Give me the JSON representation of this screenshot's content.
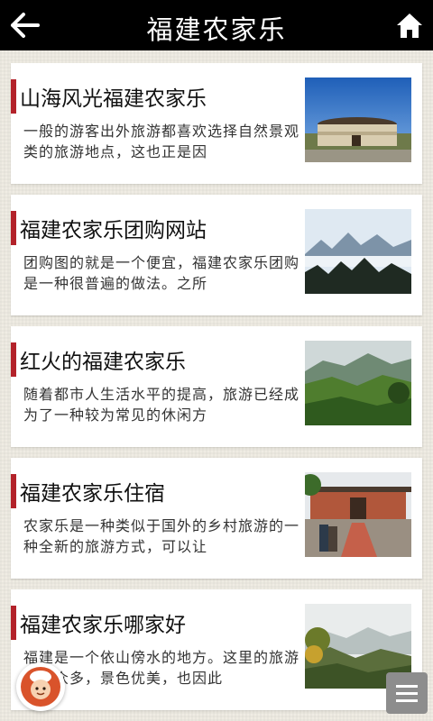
{
  "header": {
    "title": "福建农家乐",
    "back_icon": "arrow-left-icon",
    "home_icon": "home-icon"
  },
  "articles": [
    {
      "title": "山海风光福建农家乐",
      "desc": "一般的游客出外旅游都喜欢选择自然景观类的旅游地点，这也正是因",
      "image": "tulou-photo"
    },
    {
      "title": "福建农家乐团购网站",
      "desc": "团购图的就是一个便宜，福建农家乐团购是一种很普遍的做法。之所",
      "image": "mountain-peaks-photo"
    },
    {
      "title": "红火的福建农家乐",
      "desc": "随着都市人生活水平的提高，旅游已经成为了一种较为常见的休闲方",
      "image": "green-valley-photo"
    },
    {
      "title": "福建农家乐住宿",
      "desc": "农家乐是一种类似于国外的乡村旅游的一种全新的旅游方式，可以让",
      "image": "courtyard-photo"
    },
    {
      "title": "福建农家乐哪家好",
      "desc": "福建是一个依山傍水的地方。这里的旅游景点众多，景色优美，也因此",
      "image": "misty-hills-photo"
    }
  ],
  "floating": {
    "chef_icon": "chef-avatar-icon",
    "menu_icon": "menu-icon"
  },
  "colors": {
    "header_bg": "#000000",
    "accent_bar": "#b3222a",
    "card_bg": "#ffffff"
  }
}
